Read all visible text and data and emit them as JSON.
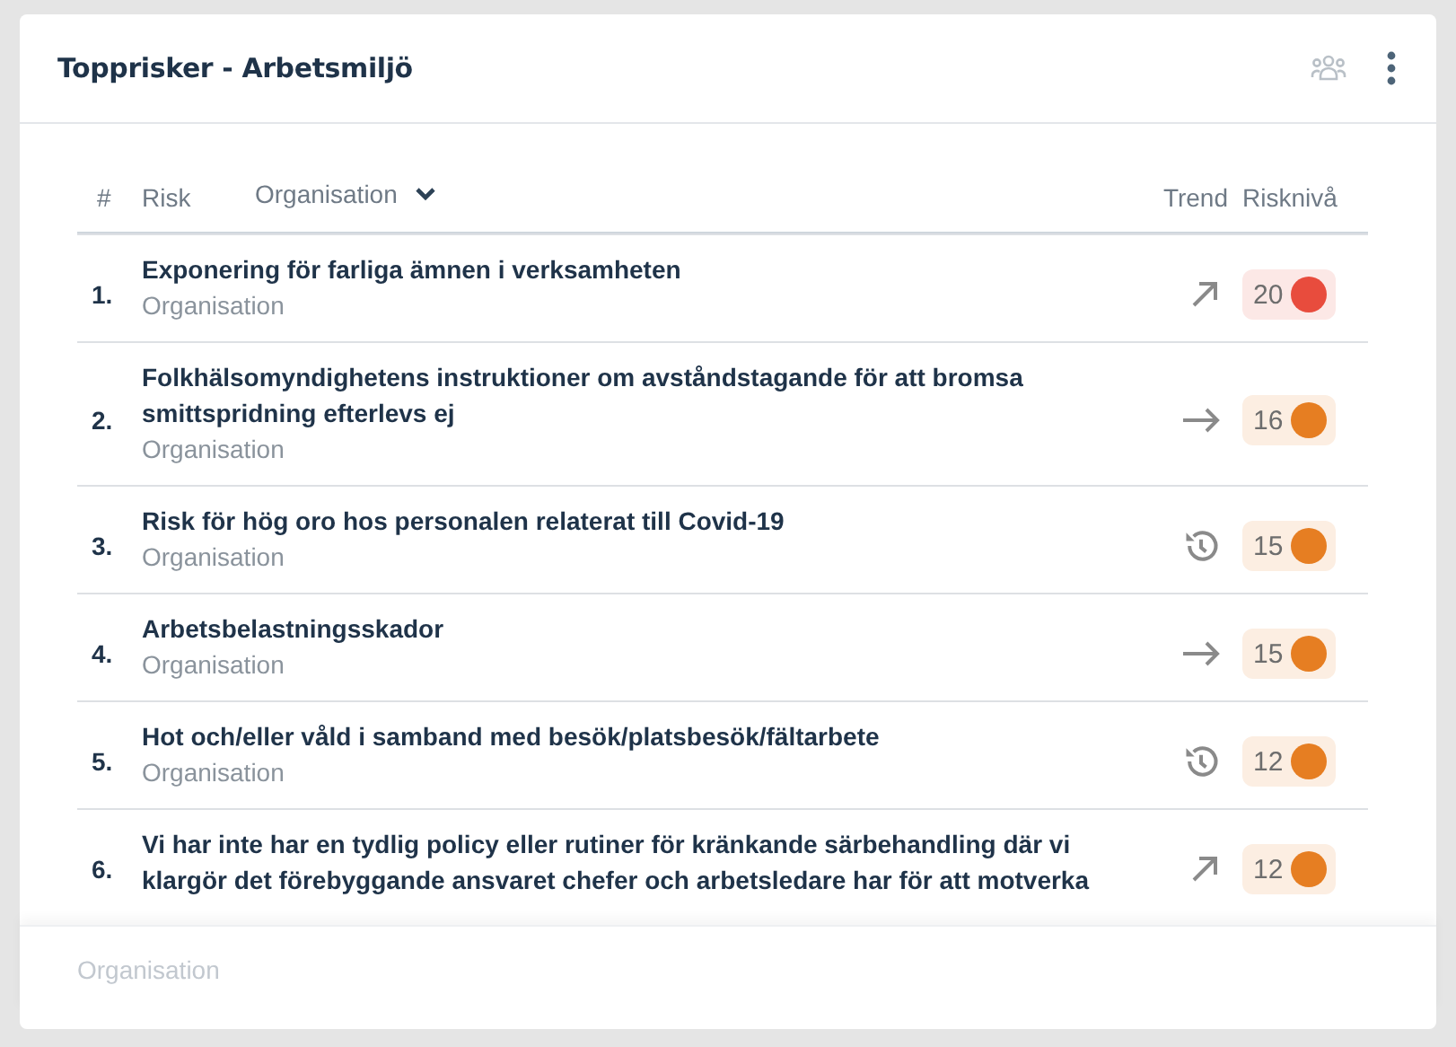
{
  "card": {
    "title": "Topprisker - Arbetsmiljö"
  },
  "table": {
    "columns": {
      "number": "#",
      "risk": "Risk",
      "filter": "Organisation",
      "trend": "Trend",
      "level": "Risknivå"
    },
    "rows": [
      {
        "number": "1.",
        "title": "Exponering för farliga ämnen i verksamheten",
        "organisation": "Organisation",
        "kind": "up",
        "score": "20",
        "color": "#e84c3d"
      },
      {
        "number": "2.",
        "title": "Folkhälsomyndighetens instruktioner om avståndstagande för att bromsa smittspridning efterlevs ej",
        "organisation": "Organisation",
        "kind": "flat",
        "score": "16",
        "color": "#e67e22"
      },
      {
        "number": "3.",
        "title": "Risk för hög oro hos personalen relaterat till Covid-19",
        "organisation": "Organisation",
        "kind": "history",
        "score": "15",
        "color": "#e67e22"
      },
      {
        "number": "4.",
        "title": "Arbetsbelastningsskador",
        "organisation": "Organisation",
        "kind": "flat",
        "score": "15",
        "color": "#e67e22"
      },
      {
        "number": "5.",
        "title": "Hot och/eller våld i samband med besök/platsbesök/fältarbete",
        "organisation": "Organisation",
        "kind": "history",
        "score": "12",
        "color": "#e67e22"
      },
      {
        "number": "6.",
        "title": "Vi har inte har en tydlig policy eller rutiner för kränkande särbehandling där vi klargör det förebyggande ansvaret chefer och arbetsledare har för att motverka",
        "kind": "up",
        "score": "12",
        "color": "#e67e22"
      }
    ]
  },
  "footer": {
    "text": "Organisation"
  }
}
